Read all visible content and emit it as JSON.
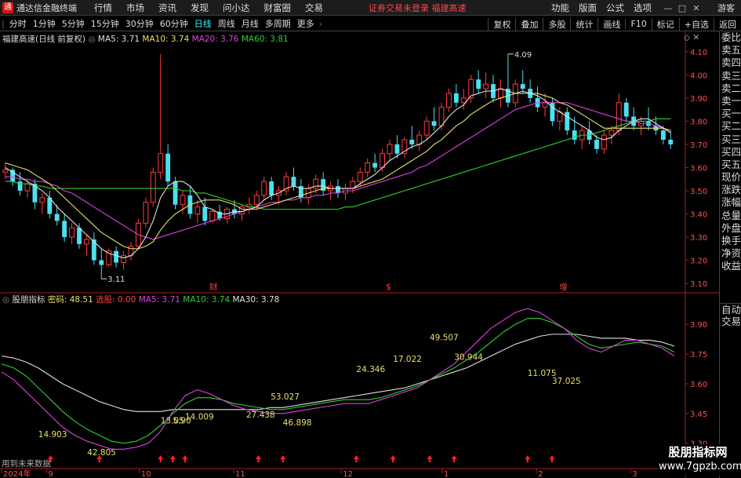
{
  "menubar": {
    "brand": "通达信金融终端",
    "menus": [
      "行情",
      "市场",
      "资讯",
      "发现",
      "问小达",
      "财富圈",
      "交易"
    ],
    "notice": "证券交易未登录  福建高速",
    "right_menus": [
      "功能",
      "版面",
      "公式",
      "选项"
    ],
    "guest": "游客",
    "win_buttons": [
      "—",
      "□",
      "✕"
    ]
  },
  "toolbar": {
    "tabs": [
      "分时",
      "1分钟",
      "5分钟",
      "15分钟",
      "30分钟",
      "60分钟",
      "日线",
      "周线",
      "月线",
      "多周期",
      "更多"
    ],
    "active": "日线",
    "right_buttons": [
      "复权",
      "叠加",
      "多股",
      "统计",
      "画线",
      "F10",
      "标记",
      "+自选",
      "返回"
    ]
  },
  "main_legend": {
    "title": "福建高速(日线 前复权)",
    "ma5": "MA5: 3.71",
    "ma10": "MA10: 3.74",
    "ma20": "MA20: 3.76",
    "ma60": "MA60: 3.81"
  },
  "sub_legend": {
    "title": "股朋指标",
    "password": "密码: 48.51",
    "select": "选股: 0.00",
    "ma5": "MA5: 3.71",
    "ma10": "MA10: 3.74",
    "ma30": "MA30: 3.78"
  },
  "footer_note": "用到未来数据",
  "event_markers": [
    "财",
    "$",
    "增"
  ],
  "quote_labels": [
    "委比",
    "卖五",
    "卖四",
    "卖三",
    "卖二",
    "卖一",
    "买一",
    "买二",
    "买三",
    "买四",
    "买五",
    "现价",
    "涨跌",
    "涨幅",
    "总量",
    "外盘",
    "换手",
    "净资",
    "收益"
  ],
  "quote_bottom": [
    "自动",
    "交易"
  ],
  "watermark": {
    "line1": "股朋指标网",
    "line2": "www.7gpzb.com"
  },
  "colors": {
    "up": "#ff3c3c",
    "down": "#4ce0f0",
    "ma5": "#e0e0e0",
    "ma10": "#e6e06a",
    "ma20": "#e040e0",
    "ma60": "#30d030",
    "brand_red": "#d11111"
  },
  "chart_data": {
    "type": "candlestick",
    "title": "福建高速(日线 前复权)",
    "y_ticks": [
      4.1,
      4.0,
      3.9,
      3.8,
      3.7,
      3.6,
      3.5,
      3.4,
      3.3,
      3.2,
      3.1
    ],
    "ylim": [
      3.07,
      4.14
    ],
    "x_ticks": [
      "2024年",
      "9",
      "10",
      "11",
      "12",
      "1",
      "2",
      "3"
    ],
    "peak_label": "4.09",
    "trough_label": "3.11",
    "ohlc": [
      [
        3.58,
        3.62,
        3.55,
        3.59
      ],
      [
        3.59,
        3.6,
        3.52,
        3.54
      ],
      [
        3.54,
        3.58,
        3.48,
        3.5
      ],
      [
        3.5,
        3.55,
        3.47,
        3.53
      ],
      [
        3.53,
        3.55,
        3.42,
        3.45
      ],
      [
        3.45,
        3.49,
        3.4,
        3.47
      ],
      [
        3.47,
        3.5,
        3.38,
        3.4
      ],
      [
        3.4,
        3.44,
        3.35,
        3.37
      ],
      [
        3.37,
        3.4,
        3.28,
        3.3
      ],
      [
        3.3,
        3.36,
        3.27,
        3.34
      ],
      [
        3.34,
        3.36,
        3.25,
        3.27
      ],
      [
        3.27,
        3.31,
        3.22,
        3.29
      ],
      [
        3.29,
        3.32,
        3.18,
        3.2
      ],
      [
        3.2,
        3.25,
        3.12,
        3.18
      ],
      [
        3.18,
        3.25,
        3.17,
        3.24
      ],
      [
        3.24,
        3.26,
        3.17,
        3.19
      ],
      [
        3.19,
        3.24,
        3.16,
        3.22
      ],
      [
        3.22,
        3.28,
        3.2,
        3.26
      ],
      [
        3.26,
        3.38,
        3.25,
        3.36
      ],
      [
        3.36,
        3.47,
        3.34,
        3.45
      ],
      [
        3.45,
        3.6,
        3.43,
        3.58
      ],
      [
        3.58,
        4.09,
        3.55,
        3.66
      ],
      [
        3.66,
        3.7,
        3.52,
        3.54
      ],
      [
        3.54,
        3.56,
        3.42,
        3.44
      ],
      [
        3.44,
        3.5,
        3.4,
        3.48
      ],
      [
        3.48,
        3.52,
        3.38,
        3.4
      ],
      [
        3.4,
        3.46,
        3.36,
        3.43
      ],
      [
        3.43,
        3.47,
        3.35,
        3.37
      ],
      [
        3.37,
        3.42,
        3.36,
        3.41
      ],
      [
        3.41,
        3.44,
        3.37,
        3.38
      ],
      [
        3.38,
        3.43,
        3.36,
        3.42
      ],
      [
        3.42,
        3.46,
        3.38,
        3.4
      ],
      [
        3.4,
        3.44,
        3.37,
        3.43
      ],
      [
        3.43,
        3.47,
        3.4,
        3.44
      ],
      [
        3.44,
        3.5,
        3.42,
        3.48
      ],
      [
        3.48,
        3.56,
        3.46,
        3.54
      ],
      [
        3.54,
        3.56,
        3.46,
        3.48
      ],
      [
        3.48,
        3.52,
        3.44,
        3.5
      ],
      [
        3.5,
        3.58,
        3.48,
        3.56
      ],
      [
        3.56,
        3.6,
        3.5,
        3.52
      ],
      [
        3.52,
        3.55,
        3.45,
        3.47
      ],
      [
        3.47,
        3.53,
        3.44,
        3.51
      ],
      [
        3.51,
        3.57,
        3.49,
        3.55
      ],
      [
        3.55,
        3.58,
        3.48,
        3.5
      ],
      [
        3.5,
        3.54,
        3.46,
        3.52
      ],
      [
        3.52,
        3.55,
        3.47,
        3.49
      ],
      [
        3.49,
        3.53,
        3.46,
        3.51
      ],
      [
        3.51,
        3.56,
        3.49,
        3.54
      ],
      [
        3.54,
        3.6,
        3.52,
        3.58
      ],
      [
        3.58,
        3.64,
        3.56,
        3.62
      ],
      [
        3.62,
        3.66,
        3.58,
        3.6
      ],
      [
        3.6,
        3.68,
        3.58,
        3.66
      ],
      [
        3.66,
        3.72,
        3.63,
        3.7
      ],
      [
        3.7,
        3.74,
        3.64,
        3.66
      ],
      [
        3.66,
        3.73,
        3.64,
        3.72
      ],
      [
        3.72,
        3.78,
        3.68,
        3.7
      ],
      [
        3.7,
        3.76,
        3.67,
        3.74
      ],
      [
        3.74,
        3.82,
        3.72,
        3.8
      ],
      [
        3.8,
        3.86,
        3.76,
        3.78
      ],
      [
        3.78,
        3.88,
        3.76,
        3.86
      ],
      [
        3.86,
        3.94,
        3.84,
        3.92
      ],
      [
        3.92,
        3.96,
        3.86,
        3.88
      ],
      [
        3.88,
        3.94,
        3.85,
        3.9
      ],
      [
        3.9,
        4.0,
        3.88,
        3.98
      ],
      [
        3.98,
        4.02,
        3.92,
        3.94
      ],
      [
        3.94,
        4.01,
        3.9,
        3.96
      ],
      [
        3.96,
        4.0,
        3.88,
        3.9
      ],
      [
        3.9,
        3.98,
        3.86,
        3.94
      ],
      [
        3.94,
        4.09,
        3.86,
        3.88
      ],
      [
        3.88,
        3.98,
        3.86,
        3.96
      ],
      [
        3.96,
        4.02,
        3.92,
        3.94
      ],
      [
        3.94,
        3.98,
        3.88,
        3.9
      ],
      [
        3.9,
        3.95,
        3.84,
        3.86
      ],
      [
        3.86,
        3.92,
        3.82,
        3.88
      ],
      [
        3.88,
        3.9,
        3.78,
        3.8
      ],
      [
        3.8,
        3.86,
        3.76,
        3.84
      ],
      [
        3.84,
        3.86,
        3.74,
        3.76
      ],
      [
        3.76,
        3.82,
        3.7,
        3.72
      ],
      [
        3.72,
        3.78,
        3.68,
        3.76
      ],
      [
        3.76,
        3.8,
        3.7,
        3.72
      ],
      [
        3.72,
        3.74,
        3.66,
        3.68
      ],
      [
        3.68,
        3.76,
        3.66,
        3.74
      ],
      [
        3.74,
        3.78,
        3.7,
        3.76
      ],
      [
        3.76,
        3.92,
        3.74,
        3.88
      ],
      [
        3.88,
        3.9,
        3.8,
        3.82
      ],
      [
        3.82,
        3.86,
        3.76,
        3.78
      ],
      [
        3.78,
        3.82,
        3.74,
        3.8
      ],
      [
        3.8,
        3.86,
        3.76,
        3.78
      ],
      [
        3.78,
        3.82,
        3.74,
        3.76
      ],
      [
        3.76,
        3.78,
        3.7,
        3.72
      ],
      [
        3.72,
        3.76,
        3.68,
        3.7
      ]
    ],
    "ma5": [
      3.6,
      3.58,
      3.56,
      3.54,
      3.52,
      3.5,
      3.47,
      3.43,
      3.4,
      3.37,
      3.34,
      3.31,
      3.28,
      3.25,
      3.23,
      3.22,
      3.21,
      3.22,
      3.25,
      3.3,
      3.37,
      3.47,
      3.52,
      3.54,
      3.54,
      3.52,
      3.48,
      3.43,
      3.42,
      3.4,
      3.4,
      3.41,
      3.41,
      3.42,
      3.43,
      3.46,
      3.48,
      3.49,
      3.51,
      3.52,
      3.51,
      3.51,
      3.52,
      3.52,
      3.51,
      3.51,
      3.51,
      3.51,
      3.53,
      3.55,
      3.57,
      3.6,
      3.63,
      3.65,
      3.67,
      3.69,
      3.7,
      3.72,
      3.75,
      3.78,
      3.82,
      3.85,
      3.87,
      3.91,
      3.92,
      3.93,
      3.93,
      3.94,
      3.93,
      3.92,
      3.93,
      3.92,
      3.91,
      3.89,
      3.86,
      3.84,
      3.82,
      3.8,
      3.78,
      3.76,
      3.73,
      3.72,
      3.73,
      3.76,
      3.78,
      3.8,
      3.81,
      3.81,
      3.79,
      3.77,
      3.75
    ],
    "ma10": [
      3.62,
      3.61,
      3.6,
      3.59,
      3.57,
      3.55,
      3.53,
      3.5,
      3.47,
      3.44,
      3.41,
      3.38,
      3.35,
      3.32,
      3.3,
      3.28,
      3.26,
      3.25,
      3.25,
      3.26,
      3.28,
      3.33,
      3.37,
      3.4,
      3.42,
      3.44,
      3.45,
      3.46,
      3.46,
      3.46,
      3.45,
      3.44,
      3.42,
      3.42,
      3.42,
      3.43,
      3.44,
      3.45,
      3.46,
      3.47,
      3.48,
      3.49,
      3.5,
      3.51,
      3.51,
      3.51,
      3.51,
      3.51,
      3.52,
      3.53,
      3.54,
      3.55,
      3.57,
      3.59,
      3.61,
      3.63,
      3.65,
      3.67,
      3.7,
      3.72,
      3.75,
      3.78,
      3.8,
      3.83,
      3.85,
      3.87,
      3.89,
      3.9,
      3.91,
      3.92,
      3.92,
      3.92,
      3.92,
      3.91,
      3.9,
      3.88,
      3.87,
      3.85,
      3.83,
      3.81,
      3.79,
      3.77,
      3.77,
      3.77,
      3.77,
      3.77,
      3.77,
      3.77,
      3.77,
      3.77,
      3.76
    ],
    "ma20": [
      3.56,
      3.56,
      3.55,
      3.55,
      3.54,
      3.54,
      3.53,
      3.52,
      3.5,
      3.49,
      3.47,
      3.45,
      3.43,
      3.41,
      3.39,
      3.37,
      3.35,
      3.33,
      3.31,
      3.3,
      3.29,
      3.3,
      3.31,
      3.32,
      3.33,
      3.34,
      3.35,
      3.36,
      3.37,
      3.38,
      3.39,
      3.4,
      3.41,
      3.42,
      3.43,
      3.44,
      3.45,
      3.45,
      3.46,
      3.46,
      3.47,
      3.47,
      3.48,
      3.48,
      3.49,
      3.49,
      3.5,
      3.5,
      3.51,
      3.52,
      3.53,
      3.54,
      3.55,
      3.56,
      3.57,
      3.58,
      3.6,
      3.61,
      3.63,
      3.65,
      3.67,
      3.69,
      3.71,
      3.73,
      3.75,
      3.77,
      3.79,
      3.81,
      3.83,
      3.85,
      3.86,
      3.87,
      3.88,
      3.88,
      3.88,
      3.88,
      3.88,
      3.87,
      3.86,
      3.85,
      3.84,
      3.83,
      3.82,
      3.81,
      3.8,
      3.8,
      3.79,
      3.79,
      3.78,
      3.77,
      3.76
    ],
    "ma60": [
      3.54,
      3.54,
      3.53,
      3.53,
      3.52,
      3.52,
      3.51,
      3.51,
      3.51,
      3.51,
      3.51,
      3.51,
      3.51,
      3.51,
      3.51,
      3.51,
      3.51,
      3.51,
      3.51,
      3.51,
      3.51,
      3.51,
      3.51,
      3.51,
      3.5,
      3.5,
      3.49,
      3.49,
      3.48,
      3.47,
      3.46,
      3.45,
      3.44,
      3.43,
      3.43,
      3.42,
      3.42,
      3.42,
      3.42,
      3.42,
      3.42,
      3.42,
      3.42,
      3.42,
      3.42,
      3.42,
      3.43,
      3.43,
      3.44,
      3.45,
      3.46,
      3.47,
      3.48,
      3.49,
      3.5,
      3.51,
      3.52,
      3.53,
      3.54,
      3.55,
      3.56,
      3.57,
      3.58,
      3.59,
      3.6,
      3.61,
      3.62,
      3.63,
      3.64,
      3.65,
      3.66,
      3.67,
      3.68,
      3.69,
      3.7,
      3.71,
      3.72,
      3.73,
      3.74,
      3.74,
      3.75,
      3.76,
      3.77,
      3.78,
      3.79,
      3.8,
      3.8,
      3.8,
      3.81,
      3.81,
      3.81
    ],
    "sub": {
      "y_ticks": [
        3.9,
        3.75,
        3.6,
        3.45,
        3.3
      ],
      "ylim": [
        3.18,
        4.0
      ],
      "line_purple": [
        3.66,
        3.62,
        3.56,
        3.5,
        3.44,
        3.38,
        3.34,
        3.31,
        3.29,
        3.27,
        3.27,
        3.28,
        3.3,
        3.36,
        3.46,
        3.54,
        3.57,
        3.55,
        3.52,
        3.49,
        3.47,
        3.46,
        3.45,
        3.45,
        3.46,
        3.47,
        3.48,
        3.49,
        3.5,
        3.5,
        3.5,
        3.52,
        3.54,
        3.56,
        3.58,
        3.62,
        3.66,
        3.7,
        3.76,
        3.82,
        3.88,
        3.92,
        3.96,
        3.98,
        3.96,
        3.92,
        3.88,
        3.82,
        3.78,
        3.76,
        3.79,
        3.82,
        3.82,
        3.8,
        3.78,
        3.74
      ],
      "line_green": [
        3.7,
        3.68,
        3.64,
        3.58,
        3.52,
        3.46,
        3.41,
        3.37,
        3.34,
        3.31,
        3.3,
        3.31,
        3.34,
        3.39,
        3.45,
        3.5,
        3.53,
        3.53,
        3.52,
        3.5,
        3.49,
        3.48,
        3.47,
        3.47,
        3.48,
        3.49,
        3.5,
        3.51,
        3.52,
        3.52,
        3.52,
        3.53,
        3.55,
        3.57,
        3.59,
        3.62,
        3.65,
        3.68,
        3.72,
        3.76,
        3.81,
        3.86,
        3.9,
        3.93,
        3.93,
        3.91,
        3.88,
        3.84,
        3.8,
        3.78,
        3.79,
        3.8,
        3.81,
        3.8,
        3.79,
        3.76
      ],
      "line_white": [
        3.74,
        3.73,
        3.71,
        3.68,
        3.64,
        3.6,
        3.57,
        3.54,
        3.51,
        3.49,
        3.47,
        3.46,
        3.46,
        3.46,
        3.47,
        3.47,
        3.47,
        3.47,
        3.47,
        3.47,
        3.47,
        3.47,
        3.48,
        3.48,
        3.49,
        3.5,
        3.51,
        3.52,
        3.53,
        3.54,
        3.55,
        3.56,
        3.57,
        3.58,
        3.6,
        3.62,
        3.64,
        3.66,
        3.68,
        3.71,
        3.74,
        3.77,
        3.8,
        3.82,
        3.84,
        3.85,
        3.85,
        3.85,
        3.84,
        3.83,
        3.83,
        3.83,
        3.82,
        3.82,
        3.81,
        3.79
      ],
      "labels": [
        {
          "text": "14.903",
          "x": 3,
          "y": 3.33
        },
        {
          "text": "42.805",
          "x": 7,
          "y": 3.24
        },
        {
          "text": "13.05",
          "x": 13,
          "y": 3.4
        },
        {
          "text": "5.90",
          "x": 14,
          "y": 3.4
        },
        {
          "text": "14.009",
          "x": 15,
          "y": 3.42
        },
        {
          "text": "27.438",
          "x": 20,
          "y": 3.43
        },
        {
          "text": "53.027",
          "x": 22,
          "y": 3.52
        },
        {
          "text": "46.898",
          "x": 23,
          "y": 3.39
        },
        {
          "text": "24.346",
          "x": 29,
          "y": 3.66
        },
        {
          "text": "17.022",
          "x": 32,
          "y": 3.71
        },
        {
          "text": "49.507",
          "x": 35,
          "y": 3.82
        },
        {
          "text": "30.944",
          "x": 37,
          "y": 3.72
        },
        {
          "text": "11.075",
          "x": 43,
          "y": 3.64
        },
        {
          "text": "37.025",
          "x": 45,
          "y": 3.6
        }
      ],
      "arrows_x": [
        4,
        8,
        13,
        14,
        15,
        21,
        23,
        29,
        32,
        35,
        37,
        43,
        45
      ]
    }
  }
}
